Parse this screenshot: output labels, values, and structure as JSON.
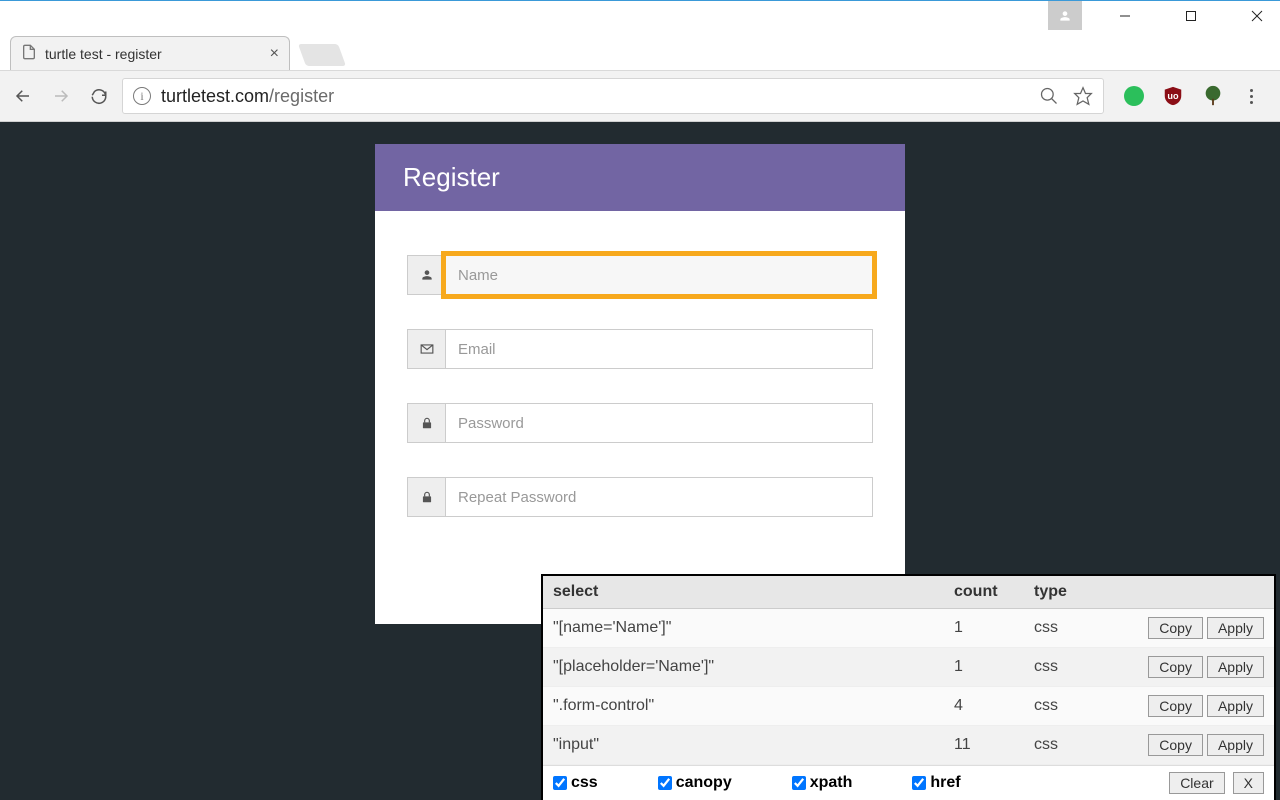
{
  "window": {
    "tab_title": "turtle test - register",
    "url_domain": "turtletest.com",
    "url_path": "/register"
  },
  "card": {
    "title": "Register",
    "fields": {
      "name": {
        "placeholder": "Name"
      },
      "email": {
        "placeholder": "Email"
      },
      "password": {
        "placeholder": "Password"
      },
      "repeat": {
        "placeholder": "Repeat Password"
      }
    }
  },
  "panel": {
    "headers": {
      "select": "select",
      "count": "count",
      "type": "type"
    },
    "rows": [
      {
        "selector": "\"[name='Name']\"",
        "count": "1",
        "type": "css"
      },
      {
        "selector": "\"[placeholder='Name']\"",
        "count": "1",
        "type": "css"
      },
      {
        "selector": "\".form-control\"",
        "count": "4",
        "type": "css"
      },
      {
        "selector": "\"input\"",
        "count": "11",
        "type": "css"
      }
    ],
    "buttons": {
      "copy": "Copy",
      "apply": "Apply",
      "clear": "Clear",
      "close": "X"
    },
    "filters": {
      "css": "css",
      "canopy": "canopy",
      "xpath": "xpath",
      "href": "href"
    }
  }
}
